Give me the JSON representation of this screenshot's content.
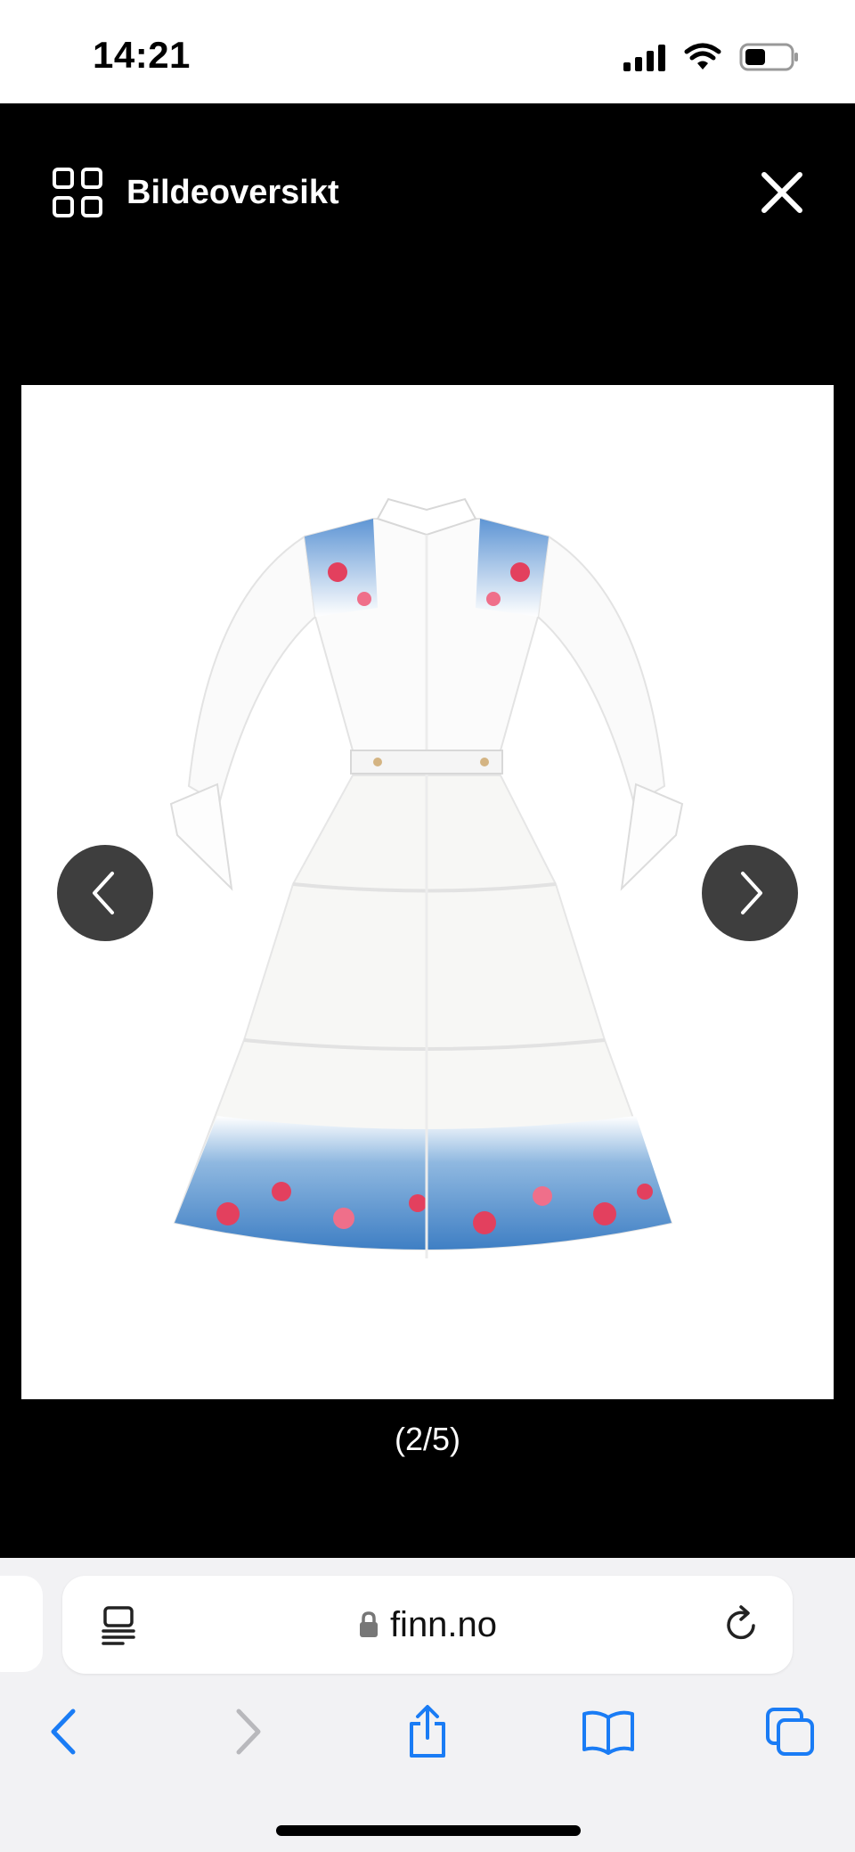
{
  "status_bar": {
    "time": "14:21",
    "icons": [
      "signal-icon",
      "wifi-icon",
      "battery-icon"
    ]
  },
  "viewer": {
    "overview_label": "Bildeoversikt",
    "overview_icon": "grid-icon",
    "close_icon": "close-icon",
    "image_alt": "White long-sleeve maxi dress with blue and red floral print",
    "counter": "(2/5)",
    "current_index": 2,
    "total_images": 5,
    "prev_icon": "chevron-left-icon",
    "next_icon": "chevron-right-icon"
  },
  "browser": {
    "url": "finn.no",
    "secure": true,
    "reader_icon": "reader-icon",
    "reload_icon": "reload-icon",
    "toolbar": [
      "back-icon",
      "forward-icon",
      "share-icon",
      "bookmarks-icon",
      "tabs-icon"
    ]
  },
  "colors": {
    "accent": "#1a7cf5",
    "overlay_bg": "#000000",
    "arrow_bg": "#3e3e3e",
    "chrome_bg": "#f2f2f4"
  }
}
